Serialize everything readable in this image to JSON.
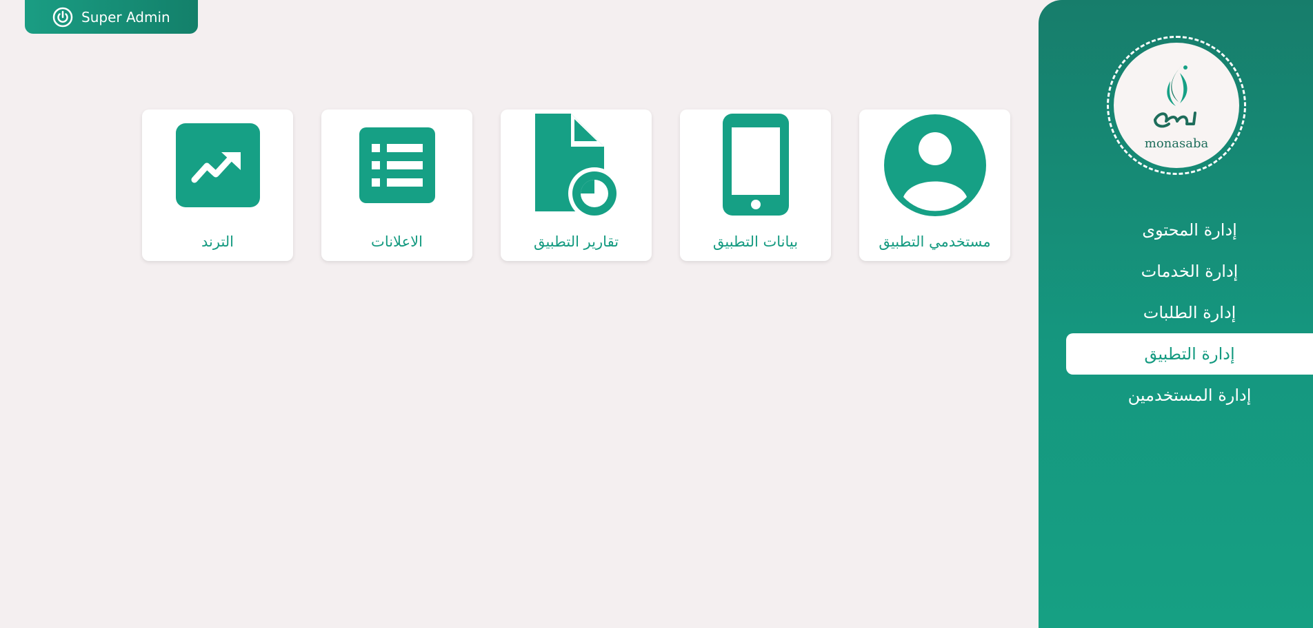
{
  "header": {
    "admin_label": "Super Admin",
    "admin_icon": "power-icon"
  },
  "sidebar": {
    "logo_text": "monasaba",
    "items": [
      {
        "label": "إدارة المحتوى",
        "active": false
      },
      {
        "label": "إدارة الخدمات",
        "active": false
      },
      {
        "label": "إدارة الطلبات",
        "active": false
      },
      {
        "label": "إدارة التطبيق",
        "active": true
      },
      {
        "label": "إدارة المستخدمين",
        "active": false
      }
    ]
  },
  "cards": [
    {
      "label": "الترند",
      "icon": "trend-icon"
    },
    {
      "label": "الاعلانات",
      "icon": "list-icon"
    },
    {
      "label": "تقارير التطبيق",
      "icon": "report-icon"
    },
    {
      "label": "بيانات التطبيق",
      "icon": "phone-icon"
    },
    {
      "label": "مستخدمي التطبيق",
      "icon": "user-icon"
    }
  ],
  "colors": {
    "accent": "#16a085",
    "background": "#f4eff0",
    "sidebar_top": "#177d6b",
    "sidebar_bottom": "#16a083"
  }
}
